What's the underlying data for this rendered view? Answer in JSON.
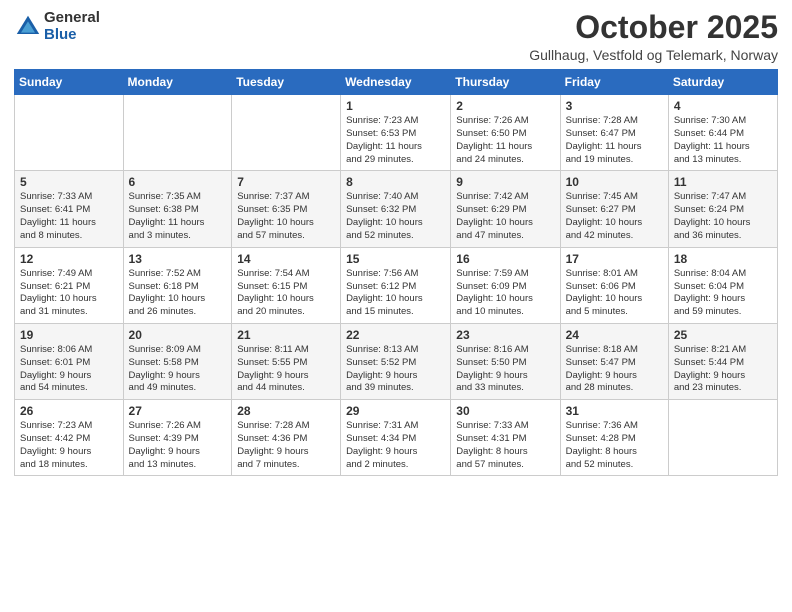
{
  "logo": {
    "general": "General",
    "blue": "Blue"
  },
  "title": "October 2025",
  "location": "Gullhaug, Vestfold og Telemark, Norway",
  "weekdays": [
    "Sunday",
    "Monday",
    "Tuesday",
    "Wednesday",
    "Thursday",
    "Friday",
    "Saturday"
  ],
  "weeks": [
    [
      {
        "day": "",
        "info": ""
      },
      {
        "day": "",
        "info": ""
      },
      {
        "day": "",
        "info": ""
      },
      {
        "day": "1",
        "info": "Sunrise: 7:23 AM\nSunset: 6:53 PM\nDaylight: 11 hours\nand 29 minutes."
      },
      {
        "day": "2",
        "info": "Sunrise: 7:26 AM\nSunset: 6:50 PM\nDaylight: 11 hours\nand 24 minutes."
      },
      {
        "day": "3",
        "info": "Sunrise: 7:28 AM\nSunset: 6:47 PM\nDaylight: 11 hours\nand 19 minutes."
      },
      {
        "day": "4",
        "info": "Sunrise: 7:30 AM\nSunset: 6:44 PM\nDaylight: 11 hours\nand 13 minutes."
      }
    ],
    [
      {
        "day": "5",
        "info": "Sunrise: 7:33 AM\nSunset: 6:41 PM\nDaylight: 11 hours\nand 8 minutes."
      },
      {
        "day": "6",
        "info": "Sunrise: 7:35 AM\nSunset: 6:38 PM\nDaylight: 11 hours\nand 3 minutes."
      },
      {
        "day": "7",
        "info": "Sunrise: 7:37 AM\nSunset: 6:35 PM\nDaylight: 10 hours\nand 57 minutes."
      },
      {
        "day": "8",
        "info": "Sunrise: 7:40 AM\nSunset: 6:32 PM\nDaylight: 10 hours\nand 52 minutes."
      },
      {
        "day": "9",
        "info": "Sunrise: 7:42 AM\nSunset: 6:29 PM\nDaylight: 10 hours\nand 47 minutes."
      },
      {
        "day": "10",
        "info": "Sunrise: 7:45 AM\nSunset: 6:27 PM\nDaylight: 10 hours\nand 42 minutes."
      },
      {
        "day": "11",
        "info": "Sunrise: 7:47 AM\nSunset: 6:24 PM\nDaylight: 10 hours\nand 36 minutes."
      }
    ],
    [
      {
        "day": "12",
        "info": "Sunrise: 7:49 AM\nSunset: 6:21 PM\nDaylight: 10 hours\nand 31 minutes."
      },
      {
        "day": "13",
        "info": "Sunrise: 7:52 AM\nSunset: 6:18 PM\nDaylight: 10 hours\nand 26 minutes."
      },
      {
        "day": "14",
        "info": "Sunrise: 7:54 AM\nSunset: 6:15 PM\nDaylight: 10 hours\nand 20 minutes."
      },
      {
        "day": "15",
        "info": "Sunrise: 7:56 AM\nSunset: 6:12 PM\nDaylight: 10 hours\nand 15 minutes."
      },
      {
        "day": "16",
        "info": "Sunrise: 7:59 AM\nSunset: 6:09 PM\nDaylight: 10 hours\nand 10 minutes."
      },
      {
        "day": "17",
        "info": "Sunrise: 8:01 AM\nSunset: 6:06 PM\nDaylight: 10 hours\nand 5 minutes."
      },
      {
        "day": "18",
        "info": "Sunrise: 8:04 AM\nSunset: 6:04 PM\nDaylight: 9 hours\nand 59 minutes."
      }
    ],
    [
      {
        "day": "19",
        "info": "Sunrise: 8:06 AM\nSunset: 6:01 PM\nDaylight: 9 hours\nand 54 minutes."
      },
      {
        "day": "20",
        "info": "Sunrise: 8:09 AM\nSunset: 5:58 PM\nDaylight: 9 hours\nand 49 minutes."
      },
      {
        "day": "21",
        "info": "Sunrise: 8:11 AM\nSunset: 5:55 PM\nDaylight: 9 hours\nand 44 minutes."
      },
      {
        "day": "22",
        "info": "Sunrise: 8:13 AM\nSunset: 5:52 PM\nDaylight: 9 hours\nand 39 minutes."
      },
      {
        "day": "23",
        "info": "Sunrise: 8:16 AM\nSunset: 5:50 PM\nDaylight: 9 hours\nand 33 minutes."
      },
      {
        "day": "24",
        "info": "Sunrise: 8:18 AM\nSunset: 5:47 PM\nDaylight: 9 hours\nand 28 minutes."
      },
      {
        "day": "25",
        "info": "Sunrise: 8:21 AM\nSunset: 5:44 PM\nDaylight: 9 hours\nand 23 minutes."
      }
    ],
    [
      {
        "day": "26",
        "info": "Sunrise: 7:23 AM\nSunset: 4:42 PM\nDaylight: 9 hours\nand 18 minutes."
      },
      {
        "day": "27",
        "info": "Sunrise: 7:26 AM\nSunset: 4:39 PM\nDaylight: 9 hours\nand 13 minutes."
      },
      {
        "day": "28",
        "info": "Sunrise: 7:28 AM\nSunset: 4:36 PM\nDaylight: 9 hours\nand 7 minutes."
      },
      {
        "day": "29",
        "info": "Sunrise: 7:31 AM\nSunset: 4:34 PM\nDaylight: 9 hours\nand 2 minutes."
      },
      {
        "day": "30",
        "info": "Sunrise: 7:33 AM\nSunset: 4:31 PM\nDaylight: 8 hours\nand 57 minutes."
      },
      {
        "day": "31",
        "info": "Sunrise: 7:36 AM\nSunset: 4:28 PM\nDaylight: 8 hours\nand 52 minutes."
      },
      {
        "day": "",
        "info": ""
      }
    ]
  ]
}
